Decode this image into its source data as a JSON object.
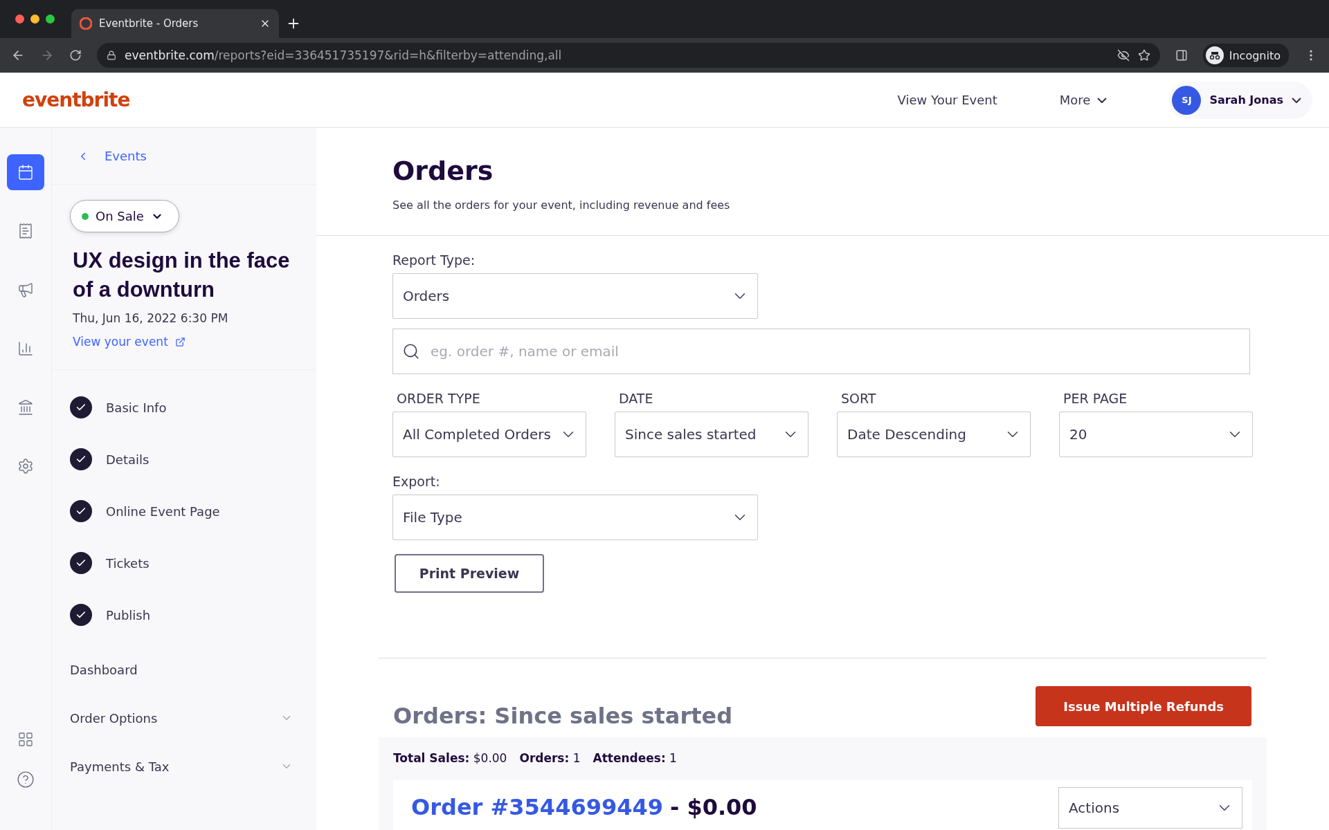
{
  "browser": {
    "tab_title": "Eventbrite - Orders",
    "url_host": "eventbrite.com",
    "url_path": "/reports?eid=336451735197&rid=h&filterby=attending,all",
    "profile_label": "Incognito"
  },
  "header": {
    "logo": "eventbrite",
    "nav": [
      "View Your Event",
      "More"
    ],
    "user": {
      "initials": "SJ",
      "name": "Sarah Jonas"
    }
  },
  "rail": [
    {
      "selected": true
    },
    {
      "selected": false
    },
    {
      "selected": false
    },
    {
      "selected": false
    },
    {
      "selected": false
    },
    {
      "selected": false
    }
  ],
  "sidebar": {
    "back_link": "Events",
    "status": {
      "label": "On Sale",
      "color": "#2dbb55"
    },
    "event_title": "UX design in the face of a downturn",
    "event_date": "Thu, Jun 16, 2022 6:30 PM",
    "view_link": "View your event",
    "steps": [
      {
        "label": "Basic Info",
        "done": true
      },
      {
        "label": "Details",
        "done": true
      },
      {
        "label": "Online Event Page",
        "done": true
      },
      {
        "label": "Tickets",
        "done": true
      },
      {
        "label": "Publish",
        "done": true
      }
    ],
    "sections": [
      {
        "label": "Dashboard",
        "kind": "link"
      },
      {
        "label": "Order Options",
        "kind": "group"
      },
      {
        "label": "Payments & Tax",
        "kind": "group"
      }
    ]
  },
  "main": {
    "title": "Orders",
    "subtitle": "See all the orders for your event, including revenue and fees",
    "report_type": {
      "label": "Report Type:",
      "value": "Orders"
    },
    "search": {
      "placeholder": "eg. order #, name or email"
    },
    "filters": [
      {
        "label": "ORDER TYPE",
        "value": "All Completed Orders"
      },
      {
        "label": "DATE",
        "value": "Since sales started"
      },
      {
        "label": "SORT",
        "value": "Date Descending"
      },
      {
        "label": "PER PAGE",
        "value": "20"
      }
    ],
    "export": {
      "label": "Export:",
      "value": "File Type"
    },
    "print_button": "Print Preview",
    "results": {
      "heading": "Orders: Since sales started",
      "refund_button": "Issue Multiple Refunds",
      "summary": [
        {
          "label": "Total Sales:",
          "value": "$0.00"
        },
        {
          "label": "Orders:",
          "value": "1"
        },
        {
          "label": "Attendees:",
          "value": "1"
        }
      ],
      "order": {
        "number": "Order #3544699449",
        "amount": "- $0.00",
        "actions": "Actions"
      }
    }
  }
}
